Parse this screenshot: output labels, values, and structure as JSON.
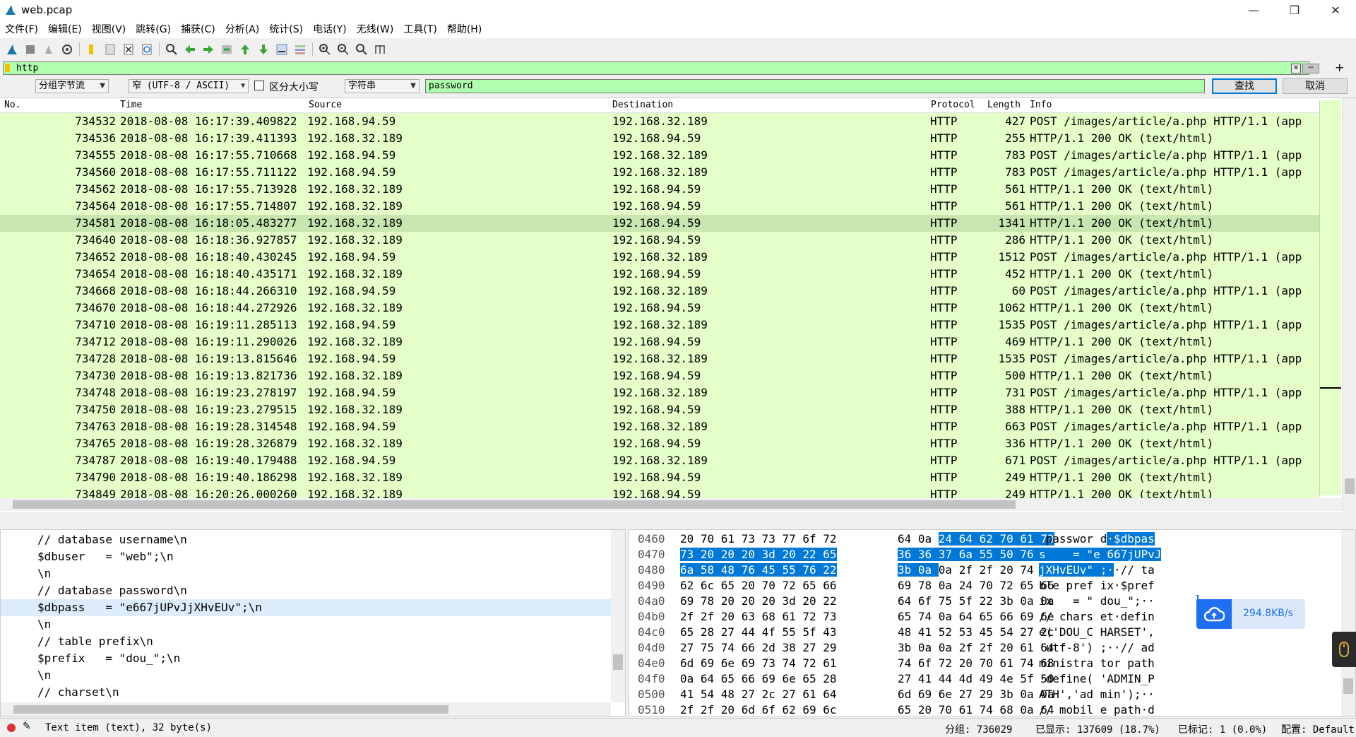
{
  "window": {
    "title": "web.pcap",
    "min": "—",
    "max": "❐",
    "close": "✕"
  },
  "menu": [
    "文件(F)",
    "编辑(E)",
    "视图(V)",
    "跳转(G)",
    "捕获(C)",
    "分析(A)",
    "统计(S)",
    "电话(Y)",
    "无线(W)",
    "工具(T)",
    "帮助(H)"
  ],
  "filter": {
    "value": "http",
    "clear": "✕",
    "apply": "⇨",
    "add": "+"
  },
  "find": {
    "search_in": "分组字节流",
    "charset": "窄 (UTF-8 / ASCII)",
    "case_label": "区分大小写",
    "type": "字符串",
    "query": "password",
    "find_btn": "查找",
    "cancel_btn": "取消"
  },
  "packet_list": {
    "columns": [
      "No.",
      "Time",
      "Source",
      "Destination",
      "Protocol",
      "Length",
      "Info"
    ],
    "rows": [
      {
        "no": "734532",
        "time": "2018-08-08 16:17:39.409822",
        "src": "192.168.94.59",
        "dst": "192.168.32.189",
        "proto": "HTTP",
        "len": "427",
        "info": "POST /images/article/a.php HTTP/1.1  (app"
      },
      {
        "no": "734536",
        "time": "2018-08-08 16:17:39.411393",
        "src": "192.168.32.189",
        "dst": "192.168.94.59",
        "proto": "HTTP",
        "len": "255",
        "info": "HTTP/1.1 200 OK  (text/html)"
      },
      {
        "no": "734555",
        "time": "2018-08-08 16:17:55.710668",
        "src": "192.168.94.59",
        "dst": "192.168.32.189",
        "proto": "HTTP",
        "len": "783",
        "info": "POST /images/article/a.php HTTP/1.1  (app"
      },
      {
        "no": "734560",
        "time": "2018-08-08 16:17:55.711122",
        "src": "192.168.94.59",
        "dst": "192.168.32.189",
        "proto": "HTTP",
        "len": "783",
        "info": "POST /images/article/a.php HTTP/1.1  (app"
      },
      {
        "no": "734562",
        "time": "2018-08-08 16:17:55.713928",
        "src": "192.168.32.189",
        "dst": "192.168.94.59",
        "proto": "HTTP",
        "len": "561",
        "info": "HTTP/1.1 200 OK  (text/html)"
      },
      {
        "no": "734564",
        "time": "2018-08-08 16:17:55.714807",
        "src": "192.168.32.189",
        "dst": "192.168.94.59",
        "proto": "HTTP",
        "len": "561",
        "info": "HTTP/1.1 200 OK  (text/html)"
      },
      {
        "no": "734581",
        "time": "2018-08-08 16:18:05.483277",
        "src": "192.168.32.189",
        "dst": "192.168.94.59",
        "proto": "HTTP",
        "len": "1341",
        "info": "HTTP/1.1 200 OK  (text/html)"
      },
      {
        "no": "734640",
        "time": "2018-08-08 16:18:36.927857",
        "src": "192.168.32.189",
        "dst": "192.168.94.59",
        "proto": "HTTP",
        "len": "286",
        "info": "HTTP/1.1 200 OK  (text/html)"
      },
      {
        "no": "734652",
        "time": "2018-08-08 16:18:40.430245",
        "src": "192.168.94.59",
        "dst": "192.168.32.189",
        "proto": "HTTP",
        "len": "1512",
        "info": "POST /images/article/a.php HTTP/1.1  (app"
      },
      {
        "no": "734654",
        "time": "2018-08-08 16:18:40.435171",
        "src": "192.168.32.189",
        "dst": "192.168.94.59",
        "proto": "HTTP",
        "len": "452",
        "info": "HTTP/1.1 200 OK  (text/html)"
      },
      {
        "no": "734668",
        "time": "2018-08-08 16:18:44.266310",
        "src": "192.168.94.59",
        "dst": "192.168.32.189",
        "proto": "HTTP",
        "len": "60",
        "info": "POST /images/article/a.php HTTP/1.1  (app"
      },
      {
        "no": "734670",
        "time": "2018-08-08 16:18:44.272926",
        "src": "192.168.32.189",
        "dst": "192.168.94.59",
        "proto": "HTTP",
        "len": "1062",
        "info": "HTTP/1.1 200 OK  (text/html)"
      },
      {
        "no": "734710",
        "time": "2018-08-08 16:19:11.285113",
        "src": "192.168.94.59",
        "dst": "192.168.32.189",
        "proto": "HTTP",
        "len": "1535",
        "info": "POST /images/article/a.php HTTP/1.1  (app"
      },
      {
        "no": "734712",
        "time": "2018-08-08 16:19:11.290026",
        "src": "192.168.32.189",
        "dst": "192.168.94.59",
        "proto": "HTTP",
        "len": "469",
        "info": "HTTP/1.1 200 OK  (text/html)"
      },
      {
        "no": "734728",
        "time": "2018-08-08 16:19:13.815646",
        "src": "192.168.94.59",
        "dst": "192.168.32.189",
        "proto": "HTTP",
        "len": "1535",
        "info": "POST /images/article/a.php HTTP/1.1  (app"
      },
      {
        "no": "734730",
        "time": "2018-08-08 16:19:13.821736",
        "src": "192.168.32.189",
        "dst": "192.168.94.59",
        "proto": "HTTP",
        "len": "500",
        "info": "HTTP/1.1 200 OK  (text/html)"
      },
      {
        "no": "734748",
        "time": "2018-08-08 16:19:23.278197",
        "src": "192.168.94.59",
        "dst": "192.168.32.189",
        "proto": "HTTP",
        "len": "731",
        "info": "POST /images/article/a.php HTTP/1.1  (app"
      },
      {
        "no": "734750",
        "time": "2018-08-08 16:19:23.279515",
        "src": "192.168.32.189",
        "dst": "192.168.94.59",
        "proto": "HTTP",
        "len": "388",
        "info": "HTTP/1.1 200 OK  (text/html)"
      },
      {
        "no": "734763",
        "time": "2018-08-08 16:19:28.314548",
        "src": "192.168.94.59",
        "dst": "192.168.32.189",
        "proto": "HTTP",
        "len": "663",
        "info": "POST /images/article/a.php HTTP/1.1  (app"
      },
      {
        "no": "734765",
        "time": "2018-08-08 16:19:28.326879",
        "src": "192.168.32.189",
        "dst": "192.168.94.59",
        "proto": "HTTP",
        "len": "336",
        "info": "HTTP/1.1 200 OK  (text/html)"
      },
      {
        "no": "734787",
        "time": "2018-08-08 16:19:40.179488",
        "src": "192.168.94.59",
        "dst": "192.168.32.189",
        "proto": "HTTP",
        "len": "671",
        "info": "POST /images/article/a.php HTTP/1.1  (app"
      },
      {
        "no": "734790",
        "time": "2018-08-08 16:19:40.186298",
        "src": "192.168.32.189",
        "dst": "192.168.94.59",
        "proto": "HTTP",
        "len": "249",
        "info": "HTTP/1.1 200 OK  (text/html)"
      },
      {
        "no": "734849",
        "time": "2018-08-08 16:20:26.000260",
        "src": "192.168.32.189",
        "dst": "192.168.94.59",
        "proto": "HTTP",
        "len": "249",
        "info": "HTTP/1.1 200 OK  (text/html)"
      }
    ],
    "selected_index": 6
  },
  "detail_lines": [
    "// database username\\n",
    "$dbuser   = \"web\";\\n",
    "\\n",
    "// database password\\n",
    "$dbpass   = \"e667jUPvJjXHvEUv\";\\n",
    "\\n",
    "// table prefix\\n",
    "$prefix   = \"dou_\";\\n",
    "\\n",
    "// charset\\n"
  ],
  "detail_selected_index": 4,
  "bytes_rows": [
    {
      "off": "0460",
      "a": "20 70 61 73 73 77 6f 72",
      "b": "64 0a 24 64 62 70 61 73",
      "asc": " passwor d·$dbpas"
    },
    {
      "off": "0470",
      "a": "73 20 20 20 3d 20 22 65",
      "b": "36 36 37 6a 55 50 76 4a",
      "asc": "s    = \"e 667jUPvJ"
    },
    {
      "off": "0480",
      "a": "6a 58 48 76 45 55 76 22",
      "b": "3b 0a 0a 2f 2f 20 74 61",
      "asc": "jXHvEUv\" ;··// ta"
    },
    {
      "off": "0490",
      "a": "62 6c 65 20 70 72 65 66",
      "b": "69 78 0a 24 70 72 65 66",
      "asc": "ble pref ix·$pref"
    },
    {
      "off": "04a0",
      "a": "69 78 20 20 20 3d 20 22",
      "b": "64 6f 75 5f 22 3b 0a 0a",
      "asc": "ix   = \" dou_\";··"
    },
    {
      "off": "04b0",
      "a": "2f 2f 20 63 68 61 72 73",
      "b": "65 74 0a 64 65 66 69 6e",
      "asc": "// chars et·defin"
    },
    {
      "off": "04c0",
      "a": "65 28 27 44 4f 55 5f 43",
      "b": "48 41 52 53 45 54 27 2c",
      "asc": "e('DOU_C HARSET',"
    },
    {
      "off": "04d0",
      "a": "27 75 74 66 2d 38 27 29",
      "b": "3b 0a 0a 2f 2f 20 61 64",
      "asc": "'utf-8') ;··// ad"
    },
    {
      "off": "04e0",
      "a": "6d 69 6e 69 73 74 72 61",
      "b": "74 6f 72 20 70 61 74 68",
      "asc": "ministra tor path"
    },
    {
      "off": "04f0",
      "a": "0a 64 65 66 69 6e 65 28",
      "b": "27 41 44 4d 49 4e 5f 50",
      "asc": "·define( 'ADMIN_P"
    },
    {
      "off": "0500",
      "a": "41 54 48 27 2c 27 61 64",
      "b": "6d 69 6e 27 29 3b 0a 0a",
      "asc": "ATH','ad min');··"
    },
    {
      "off": "0510",
      "a": "2f 2f 20 6d 6f 62 69 6c",
      "b": "65 20 70 61 74 68 0a 64",
      "asc": "// mobil e path·d"
    }
  ],
  "netspeed": {
    "value": "294.8KB/s",
    "badge": "1"
  },
  "status": {
    "field": "Text item (text), 32 byte(s)",
    "packets": "分组: 736029",
    "displayed": "已显示: 137609 (18.7%)",
    "marked": "已标记: 1 (0.0%)",
    "profile": "配置: Default"
  }
}
